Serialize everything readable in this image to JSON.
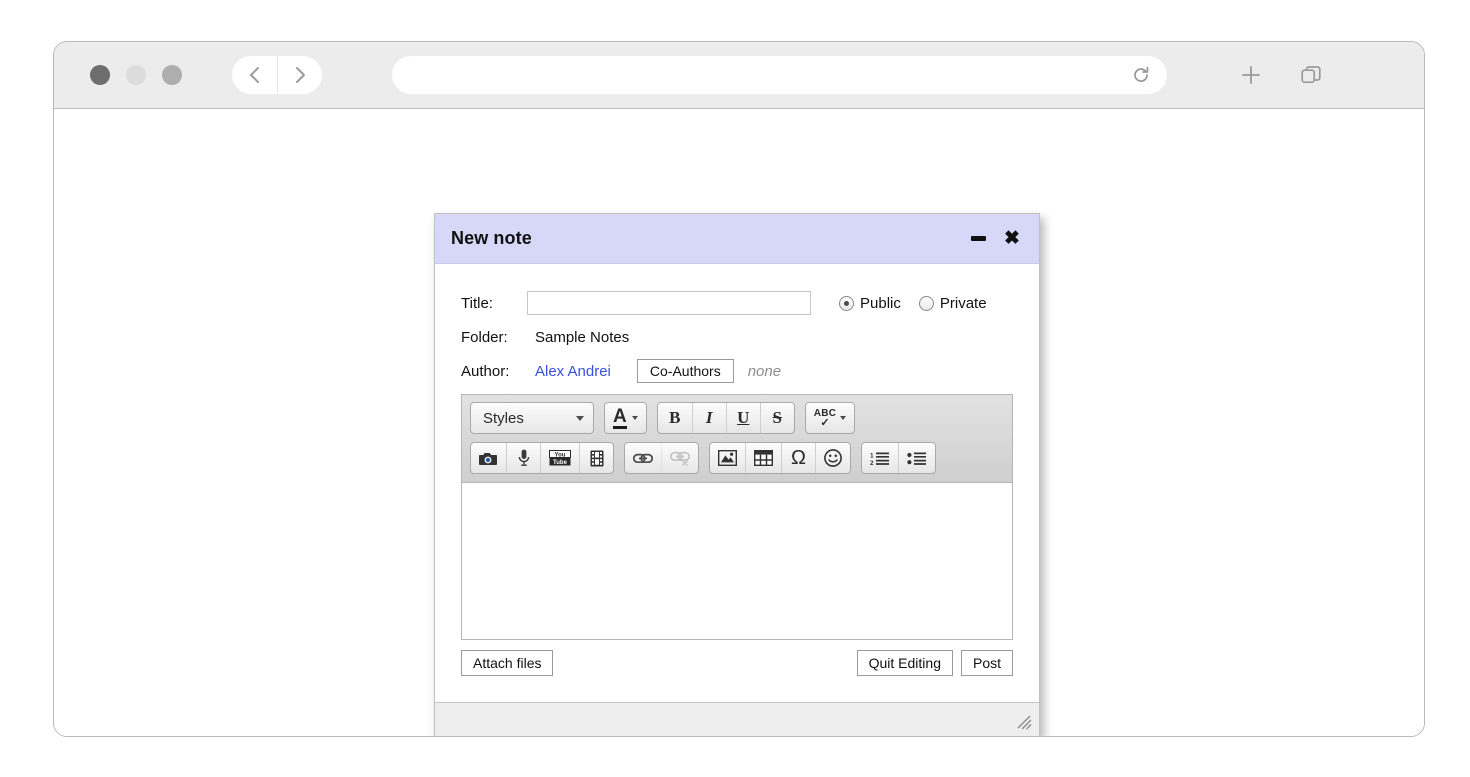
{
  "browser": {
    "traffic_lights": [
      "close",
      "minimize",
      "maximize"
    ],
    "back_label": "Back",
    "forward_label": "Forward",
    "url_value": "",
    "url_placeholder": "",
    "reload_label": "Reload",
    "new_tab_label": "New Tab",
    "tab_overview_label": "Tab Overview",
    "icons": {
      "back": "chevron-left-icon",
      "forward": "chevron-right-icon",
      "reload": "reload-icon",
      "new_tab": "plus-icon",
      "tab_overview": "copy-tabs-icon"
    }
  },
  "dialog": {
    "title": "New note",
    "titlebar_color": "#d7d7f8",
    "minimize_label": "Minimize",
    "close_label": "Close",
    "fields": {
      "title_label": "Title:",
      "title_value": "",
      "folder_label": "Folder:",
      "folder_value": "Sample Notes",
      "author_label": "Author:",
      "author_value": "Alex Andrei",
      "author_link_color": "#3b4fe0",
      "coauthors_button": "Co-Authors",
      "coauthors_value": "none"
    },
    "visibility": {
      "options": [
        {
          "label": "Public",
          "selected": true
        },
        {
          "label": "Private",
          "selected": false
        }
      ]
    },
    "toolbar": {
      "row1": [
        {
          "group": "styles",
          "items": [
            {
              "name": "styles-dropdown",
              "label": "Styles",
              "icon": "chevron-down-icon"
            }
          ]
        },
        {
          "group": "textcolor",
          "items": [
            {
              "name": "text-color",
              "label": "A",
              "icon": "text-color-icon"
            }
          ]
        },
        {
          "group": "format",
          "items": [
            {
              "name": "bold",
              "label": "B",
              "icon": "bold-icon"
            },
            {
              "name": "italic",
              "label": "I",
              "icon": "italic-icon"
            },
            {
              "name": "underline",
              "label": "U",
              "icon": "underline-icon"
            },
            {
              "name": "strikethrough",
              "label": "S",
              "icon": "strikethrough-icon"
            }
          ]
        },
        {
          "group": "spellcheck",
          "items": [
            {
              "name": "spellcheck",
              "label": "ABC",
              "icon": "spellcheck-icon"
            }
          ]
        }
      ],
      "row2": [
        {
          "group": "media",
          "items": [
            {
              "name": "camera",
              "label": "",
              "icon": "camera-icon"
            },
            {
              "name": "microphone",
              "label": "",
              "icon": "microphone-icon"
            },
            {
              "name": "youtube",
              "label": "You Tube",
              "icon": "youtube-icon"
            },
            {
              "name": "video",
              "label": "",
              "icon": "film-strip-icon"
            }
          ]
        },
        {
          "group": "link",
          "items": [
            {
              "name": "insert-link",
              "label": "",
              "icon": "link-icon",
              "disabled": false
            },
            {
              "name": "remove-link",
              "label": "",
              "icon": "unlink-icon",
              "disabled": true
            }
          ]
        },
        {
          "group": "insert",
          "items": [
            {
              "name": "insert-image",
              "label": "",
              "icon": "image-icon"
            },
            {
              "name": "insert-table",
              "label": "",
              "icon": "table-icon"
            },
            {
              "name": "special-character",
              "label": "Ω",
              "icon": "omega-icon"
            },
            {
              "name": "insert-emoji",
              "label": "",
              "icon": "smiley-icon"
            }
          ]
        },
        {
          "group": "lists",
          "items": [
            {
              "name": "numbered-list",
              "label": "",
              "icon": "numbered-list-icon"
            },
            {
              "name": "bulleted-list",
              "label": "",
              "icon": "bulleted-list-icon"
            }
          ]
        }
      ]
    },
    "editor_content": "",
    "actions": {
      "attach_files": "Attach files",
      "quit_editing": "Quit Editing",
      "post": "Post"
    },
    "resize_grip": "resize-grip-icon"
  }
}
